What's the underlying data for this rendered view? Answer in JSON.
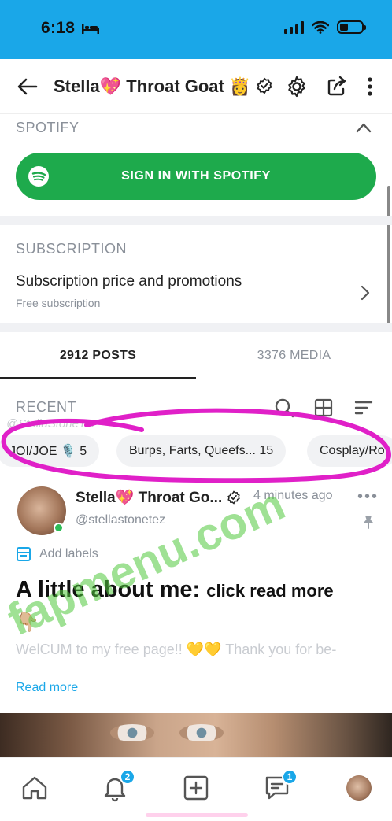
{
  "status_bar": {
    "time": "6:18",
    "bg_color": "#1aa7e8"
  },
  "header": {
    "title": "Stella💖 Throat Goat 👸"
  },
  "spotify": {
    "section_label": "SPOTIFY",
    "button_label": "SIGN IN WITH SPOTIFY",
    "button_color": "#1eaa4c"
  },
  "subscription": {
    "section_label": "SUBSCRIPTION",
    "price_label": "Subscription price and promotions",
    "price_sub": "Free subscription"
  },
  "tabs": [
    {
      "label": "2912 POSTS",
      "active": true
    },
    {
      "label": "3376 MEDIA",
      "active": false
    }
  ],
  "recent": {
    "label": "RECENT",
    "watermark_handle": "@StellaStoneTez"
  },
  "chips": [
    {
      "label": "JOI/JOE 🎙️ 5"
    },
    {
      "label": "Burps, Farts, Queefs... 15"
    },
    {
      "label": "Cosplay/Ro"
    }
  ],
  "annotation_color": "#e020c8",
  "post": {
    "author": "Stella💖 Throat Go...",
    "time": "4 minutes ago",
    "handle": "@stellastonetez",
    "more": "•••",
    "add_labels": "Add labels",
    "heading": "A little about me:",
    "heading_small": "click read more",
    "emoji": "👇🏼",
    "body": "WelCUM to my free page!! 💛💛 Thank you for be-",
    "read_more": "Read more"
  },
  "watermark": "fapmenu.com",
  "bottom_nav": {
    "notifications_badge": "2",
    "messages_badge": "1",
    "accent_color": "#1aa7e8"
  }
}
